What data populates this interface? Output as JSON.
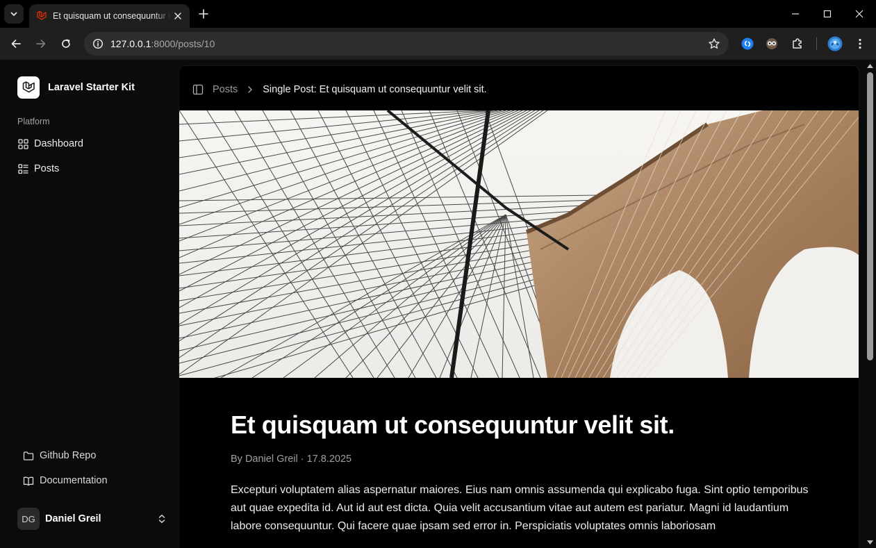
{
  "browser": {
    "tab": {
      "title": "Et quisquam ut consequuntur velit sit.",
      "favicon": "laravel-icon"
    },
    "url": {
      "host": "127.0.0.1",
      "path": ":8000/posts/10"
    }
  },
  "sidebar": {
    "brand": "Laravel Starter Kit",
    "group_label": "Platform",
    "items": [
      {
        "label": "Dashboard",
        "icon": "grid-icon"
      },
      {
        "label": "Posts",
        "icon": "list-icon"
      }
    ],
    "footer_links": [
      {
        "label": "Github Repo",
        "icon": "folder-icon"
      },
      {
        "label": "Documentation",
        "icon": "book-icon"
      }
    ],
    "user": {
      "initials": "DG",
      "name": "Daniel Greil"
    }
  },
  "breadcrumbs": {
    "parent": "Posts",
    "current": "Single Post: Et quisquam ut consequuntur velit sit."
  },
  "post": {
    "title": "Et quisquam ut consequuntur velit sit.",
    "meta": "By Daniel Greil · 17.8.2025",
    "body": "Excepturi voluptatem alias aspernatur maiores. Eius nam omnis assumenda qui explicabo fuga. Sint optio temporibus aut quae expedita id. Aut id aut est dicta. Quia velit accusantium vitae aut autem est pariatur. Magni id laudantium labore consequuntur. Qui facere quae ipsam sed error in. Perspiciatis voluptates omnis laboriosam"
  },
  "colors": {
    "accent": "#f53003",
    "page_bg": "#0b0b0b",
    "content_bg": "#000000"
  }
}
